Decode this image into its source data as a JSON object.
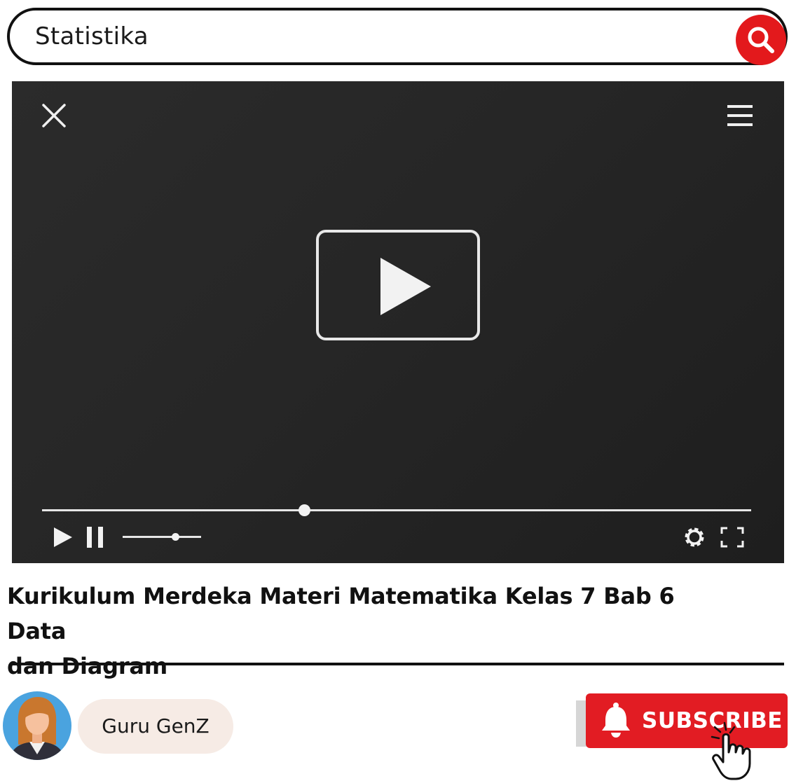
{
  "search": {
    "value": "Statistika",
    "search_icon": "search-icon"
  },
  "player": {
    "close_icon": "close-icon",
    "menu_icon": "menu-icon",
    "big_play_icon": "play-icon",
    "progress": 0.37,
    "volume": 0.67,
    "controls": {
      "play_icon": "play-icon",
      "pause_icon": "pause-icon",
      "settings_icon": "gear-icon",
      "fullscreen_icon": "fullscreen-icon"
    }
  },
  "video": {
    "title_line1": "Kurikulum Merdeka Materi Matematika Kelas 7 Bab 6 Data",
    "title_line2": "dan Diagram"
  },
  "channel": {
    "name": "Guru GenZ",
    "avatar_icon": "avatar"
  },
  "subscribe": {
    "label": "SUBSCRIBE",
    "bell_icon": "bell-icon",
    "cursor_icon": "hand-cursor-icon"
  },
  "colors": {
    "accent_red": "#e3191c",
    "player_bg": "#262626",
    "pill_bg": "#f6ebe5"
  }
}
